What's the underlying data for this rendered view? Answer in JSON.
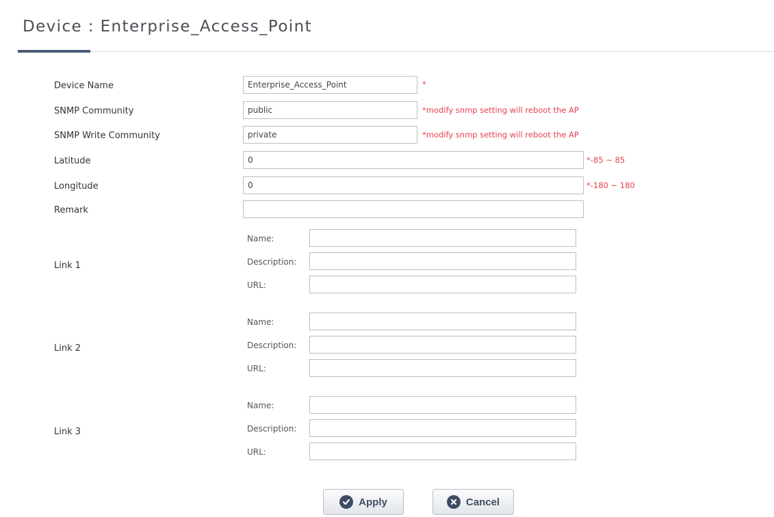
{
  "header": {
    "title": "Device : Enterprise_Access_Point"
  },
  "form": {
    "device_name": {
      "label": "Device Name",
      "value": "Enterprise_Access_Point",
      "note": "*"
    },
    "snmp_community": {
      "label": "SNMP Community",
      "value": "public",
      "note": "*modify snmp setting will reboot the AP"
    },
    "snmp_write_community": {
      "label": "SNMP Write Community",
      "value": "private",
      "note": "*modify snmp setting will reboot the AP"
    },
    "latitude": {
      "label": "Latitude",
      "value": "0",
      "note": "*-85 ~ 85"
    },
    "longitude": {
      "label": "Longitude",
      "value": "0",
      "note": "*-180 ~ 180"
    },
    "remark": {
      "label": "Remark",
      "value": ""
    }
  },
  "links": [
    {
      "label": "Link 1",
      "name_label": "Name:",
      "description_label": "Description:",
      "url_label": "URL:",
      "name": "",
      "description": "",
      "url": ""
    },
    {
      "label": "Link 2",
      "name_label": "Name:",
      "description_label": "Description:",
      "url_label": "URL:",
      "name": "",
      "description": "",
      "url": ""
    },
    {
      "label": "Link 3",
      "name_label": "Name:",
      "description_label": "Description:",
      "url_label": "URL:",
      "name": "",
      "description": "",
      "url": ""
    }
  ],
  "buttons": {
    "apply": {
      "label": "Apply",
      "icon": "check-circle-icon"
    },
    "cancel": {
      "label": "Cancel",
      "icon": "x-circle-icon"
    }
  },
  "colors": {
    "accent": "#4a5a74",
    "required_note": "#e8404e",
    "button_text": "#3f4d63"
  }
}
